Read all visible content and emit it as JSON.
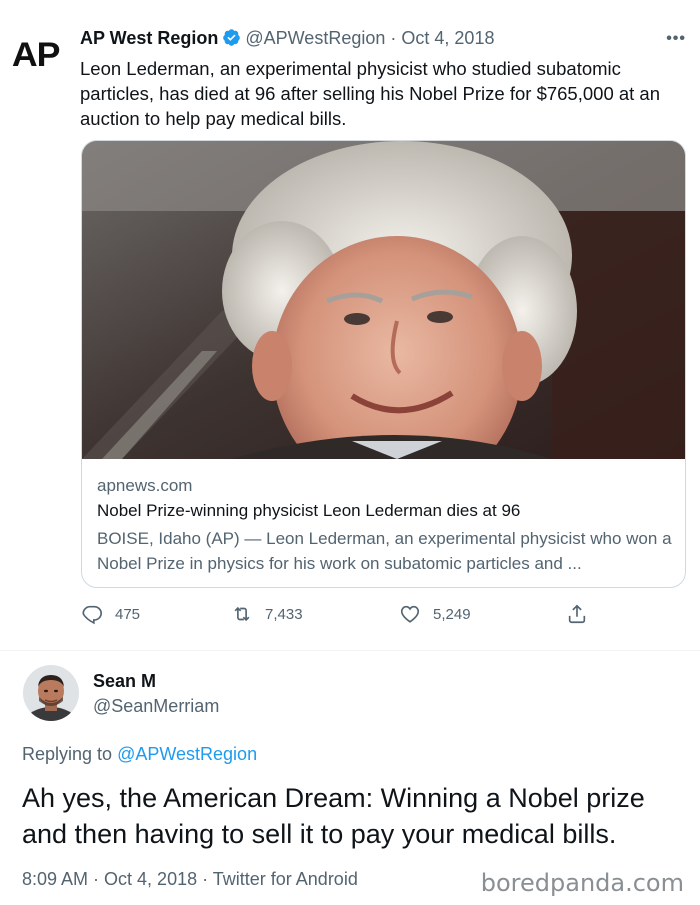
{
  "tweet": {
    "logo_text": "AP",
    "author_name": "AP West Region",
    "author_handle": "@APWestRegion",
    "separator": "·",
    "date": "Oct 4, 2018",
    "more_label": "•••",
    "text": "Leon Lederman, an experimental physicist who studied subatomic particles, has died at 96 after selling his Nobel Prize for $765,000 at an auction to help pay medical bills.",
    "card": {
      "image_icon": "portrait-photo",
      "domain": "apnews.com",
      "title": "Nobel Prize-winning physicist Leon Lederman dies at 96",
      "description": "BOISE, Idaho (AP) — Leon Lederman, an experimental physicist who won a Nobel Prize in physics for his work on subatomic particles and ..."
    },
    "actions": {
      "replies": "475",
      "retweets": "7,433",
      "likes": "5,249"
    }
  },
  "reply": {
    "author_name": "Sean M",
    "author_handle": "@SeanMerriam",
    "replying_to_prefix": "Replying to",
    "replying_to_handle": "@APWestRegion",
    "text": "Ah yes, the American Dream: Winning a Nobel prize and then having to sell it to pay your medical bills.",
    "meta": "8:09 AM · Oct 4, 2018 · Twitter for Android"
  },
  "watermark": "boredpanda.com",
  "colors": {
    "accent": "#1d9bf0",
    "secondary_text": "#536471",
    "primary_text": "#0f1419"
  }
}
